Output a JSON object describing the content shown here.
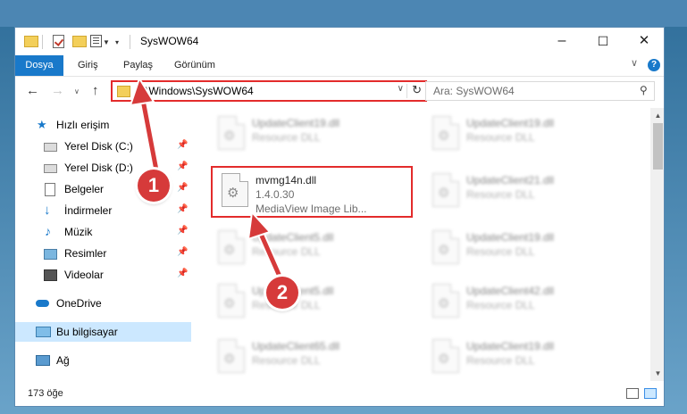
{
  "window": {
    "title": "SysWOW64",
    "controls": {
      "minimize": "–",
      "maximize": "☐",
      "close": "✕"
    }
  },
  "ribbon": {
    "tabs": [
      "Dosya",
      "Giriş",
      "Paylaş",
      "Görünüm"
    ],
    "help": "?"
  },
  "address": {
    "path": "C:\\Windows\\SysWOW64"
  },
  "search": {
    "placeholder": "Ara: SysWOW64"
  },
  "nav": {
    "items": [
      {
        "label": "Hızlı erişim",
        "icon": "star-icon"
      },
      {
        "label": "Yerel Disk (C:)",
        "icon": "drive-icon",
        "pinned": true
      },
      {
        "label": "Yerel Disk (D:)",
        "icon": "drive-icon",
        "pinned": true
      },
      {
        "label": "Belgeler",
        "icon": "document-icon",
        "pinned": true
      },
      {
        "label": "İndirmeler",
        "icon": "download-icon",
        "pinned": true
      },
      {
        "label": "Müzik",
        "icon": "music-icon",
        "pinned": true
      },
      {
        "label": "Resimler",
        "icon": "pictures-icon",
        "pinned": true
      },
      {
        "label": "Videolar",
        "icon": "video-icon",
        "pinned": true
      },
      {
        "label": "OneDrive",
        "icon": "cloud-icon"
      },
      {
        "label": "Bu bilgisayar",
        "icon": "computer-icon",
        "selected": true
      },
      {
        "label": "Ağ",
        "icon": "network-icon"
      }
    ]
  },
  "files": {
    "left": [
      {
        "name": "UpdateClient19.dll",
        "type": "Resource DLL"
      },
      {
        "name": "mvmg14n.dll",
        "version": "1.4.0.30",
        "desc": "MediaView Image Lib..."
      },
      {
        "name": "UpdateClient5.dll",
        "type": "Resource DLL"
      },
      {
        "name": "UpdateClient5.dll",
        "type": "Resource DLL"
      },
      {
        "name": "UpdateClient65.dll",
        "type": "Resource DLL"
      }
    ],
    "right": [
      {
        "name": "UpdateClient19.dll",
        "type": "Resource DLL"
      },
      {
        "name": "UpdateClient21.dll",
        "type": "Resource DLL"
      },
      {
        "name": "UpdateClient19.dll",
        "type": "Resource DLL"
      },
      {
        "name": "UpdateClient42.dll",
        "type": "Resource DLL"
      },
      {
        "name": "UpdateClient19.dll",
        "type": "Resource DLL"
      }
    ]
  },
  "status": {
    "count": "173 öğe"
  },
  "annotations": {
    "step1": "1",
    "step2": "2",
    "color": "#d63a3a"
  }
}
